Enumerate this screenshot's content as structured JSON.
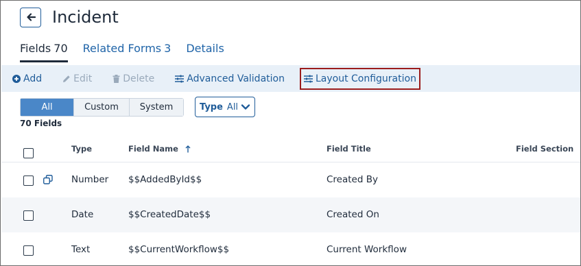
{
  "header": {
    "title": "Incident"
  },
  "tabs": [
    {
      "label": "Fields",
      "count": "70"
    },
    {
      "label": "Related Forms",
      "count": "3"
    },
    {
      "label": "Details",
      "count": ""
    }
  ],
  "toolbar": {
    "add": "Add",
    "edit": "Edit",
    "delete": "Delete",
    "advanced_validation": "Advanced Validation",
    "layout_configuration": "Layout Configuration"
  },
  "filters": {
    "segments": [
      "All",
      "Custom",
      "System"
    ],
    "active_segment": "All",
    "type_label": "Type",
    "type_value": "All"
  },
  "field_count": "70 Fields",
  "table": {
    "columns": [
      "Type",
      "Field Name",
      "Field Title",
      "Field Section"
    ],
    "sort_column": "Field Name",
    "sort_direction": "ascending",
    "rows": [
      {
        "type": "Number",
        "field_name": "$$AddedById$$",
        "field_title": "Created By",
        "field_section": ""
      },
      {
        "type": "Date",
        "field_name": "$$CreatedDate$$",
        "field_title": "Created On",
        "field_section": ""
      },
      {
        "type": "Text",
        "field_name": "$$CurrentWorkflow$$",
        "field_title": "Current Workflow",
        "field_section": ""
      }
    ]
  },
  "colors": {
    "accent": "#1f5c99",
    "tab_link": "#1f64a8",
    "toolbar_bg": "#e8f0f8",
    "segment_active": "#4a87c8",
    "highlight_border": "#9b1c1c"
  },
  "icons": {
    "back": "arrow-left-icon",
    "add": "plus-circle-icon",
    "edit": "pencil-icon",
    "delete": "trash-icon",
    "advanced_validation": "sliders-icon",
    "layout_configuration": "sliders-icon",
    "type_dropdown": "chevron-down-icon",
    "sort": "arrow-up-icon",
    "row_copy": "copy-icon"
  }
}
